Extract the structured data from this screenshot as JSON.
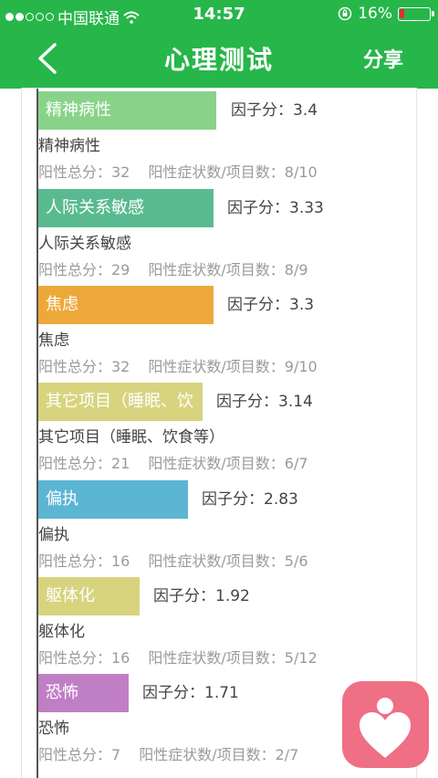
{
  "status_bar": {
    "carrier": "中国联通",
    "time": "14:57",
    "battery": "16%"
  },
  "nav": {
    "title": "心理测试",
    "share": "分享"
  },
  "items": [
    {
      "bar_label": "精神病性",
      "score": "因子分：3.4",
      "name": "精神病性",
      "total": "阳性总分：32",
      "ratio": "阳性症状数/项目数：8/10",
      "color": "#88d389",
      "value": 3.4
    },
    {
      "bar_label": "人际关系敏感",
      "score": "因子分：3.33",
      "name": "人际关系敏感",
      "total": "阳性总分：29",
      "ratio": "阳性症状数/项目数：8/9",
      "color": "#5aba8f",
      "value": 3.33
    },
    {
      "bar_label": "焦虑",
      "score": "因子分：3.3",
      "name": "焦虑",
      "total": "阳性总分：32",
      "ratio": "阳性症状数/项目数：9/10",
      "color": "#eda83a",
      "value": 3.3
    },
    {
      "bar_label": "其它项目（睡眠、饮",
      "score": "因子分：3.14",
      "name": "其它项目（睡眠、饮食等）",
      "total": "阳性总分：21",
      "ratio": "阳性症状数/项目数：6/7",
      "color": "#d8d37f",
      "value": 3.14
    },
    {
      "bar_label": "偏执",
      "score": "因子分：2.83",
      "name": "偏执",
      "total": "阳性总分：16",
      "ratio": "阳性症状数/项目数：5/6",
      "color": "#5cb5d3",
      "value": 2.83
    },
    {
      "bar_label": "躯体化",
      "score": "因子分：1.92",
      "name": "躯体化",
      "total": "阳性总分：16",
      "ratio": "阳性症状数/项目数：5/12",
      "color": "#d8d37f",
      "value": 1.92
    },
    {
      "bar_label": "恐怖",
      "score": "因子分：1.71",
      "name": "恐怖",
      "total": "阳性总分：7",
      "ratio": "阳性症状数/项目数：2/7",
      "color": "#c07fc5",
      "value": 1.71
    }
  ]
}
